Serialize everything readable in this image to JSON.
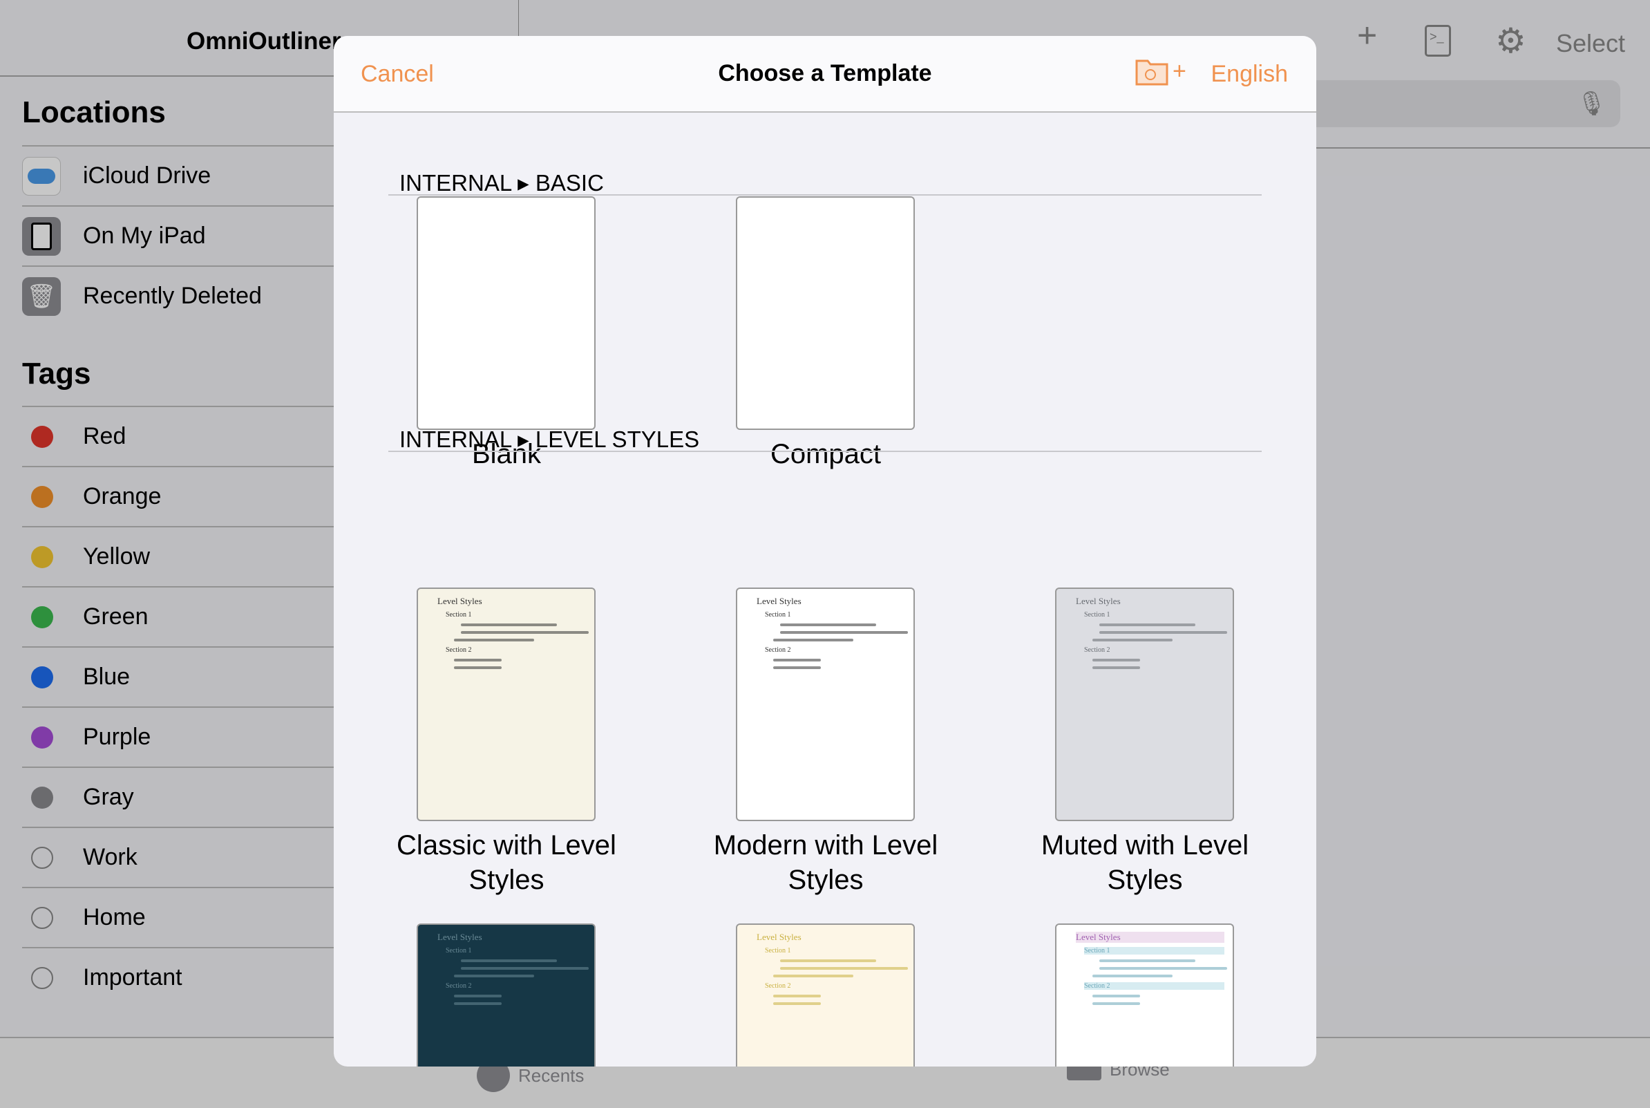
{
  "sidebar": {
    "title": "OmniOutliner",
    "locations_heading": "Locations",
    "locations": [
      {
        "label": "iCloud Drive",
        "icon": "icloud-icon"
      },
      {
        "label": "On My iPad",
        "icon": "ipad-icon"
      },
      {
        "label": "Recently Deleted",
        "icon": "trash-icon"
      }
    ],
    "tags_heading": "Tags",
    "tags": [
      {
        "label": "Red",
        "color": "#e0352b"
      },
      {
        "label": "Orange",
        "color": "#f0902a"
      },
      {
        "label": "Yellow",
        "color": "#f2c631"
      },
      {
        "label": "Green",
        "color": "#3cb94f"
      },
      {
        "label": "Blue",
        "color": "#1e6ef0"
      },
      {
        "label": "Purple",
        "color": "#a44cd6"
      },
      {
        "label": "Gray",
        "color": "#8a8a8e"
      },
      {
        "label": "Work",
        "color": ""
      },
      {
        "label": "Home",
        "color": ""
      },
      {
        "label": "Important",
        "color": ""
      }
    ]
  },
  "toolbar": {
    "select_label": "Select",
    "add_icon": "plus-icon",
    "terminal_icon": "terminal-icon",
    "settings_icon": "gear-icon",
    "mic_icon": "microphone-icon"
  },
  "tabbar": {
    "recents": "Recents",
    "browse": "Browse"
  },
  "modal": {
    "cancel": "Cancel",
    "title": "Choose a Template",
    "language": "English",
    "folder_icon": "add-template-folder-icon",
    "accent": "#f0924f",
    "sections": [
      {
        "header": "INTERNAL ▸ BASIC",
        "templates": [
          {
            "name": "Blank",
            "theme": "blank",
            "bg": "#ffffff"
          },
          {
            "name": "Compact",
            "theme": "blank",
            "bg": "#ffffff"
          }
        ]
      },
      {
        "header": "INTERNAL ▸ LEVEL STYLES",
        "templates": [
          {
            "name": "Classic with Level Styles",
            "theme": "classic",
            "bg": "#f6f3e6",
            "fg": "#333333"
          },
          {
            "name": "Modern with Level Styles",
            "theme": "modern",
            "bg": "#ffffff",
            "fg": "#333333"
          },
          {
            "name": "Muted with Level Styles",
            "theme": "muted",
            "bg": "#dcdde2",
            "fg": "#666a70"
          },
          {
            "name": "",
            "theme": "dark",
            "bg": "#163746",
            "fg": "#6a8a96"
          },
          {
            "name": "",
            "theme": "cream",
            "bg": "#fdf6e6",
            "fg": "#c9b040"
          },
          {
            "name": "",
            "theme": "pastel",
            "bg": "#ffffff",
            "fg": "#6aa6b8"
          }
        ]
      }
    ],
    "thumbnail_text": {
      "title": "Level Styles",
      "section1": "Section 1",
      "section2": "Section 2"
    }
  }
}
